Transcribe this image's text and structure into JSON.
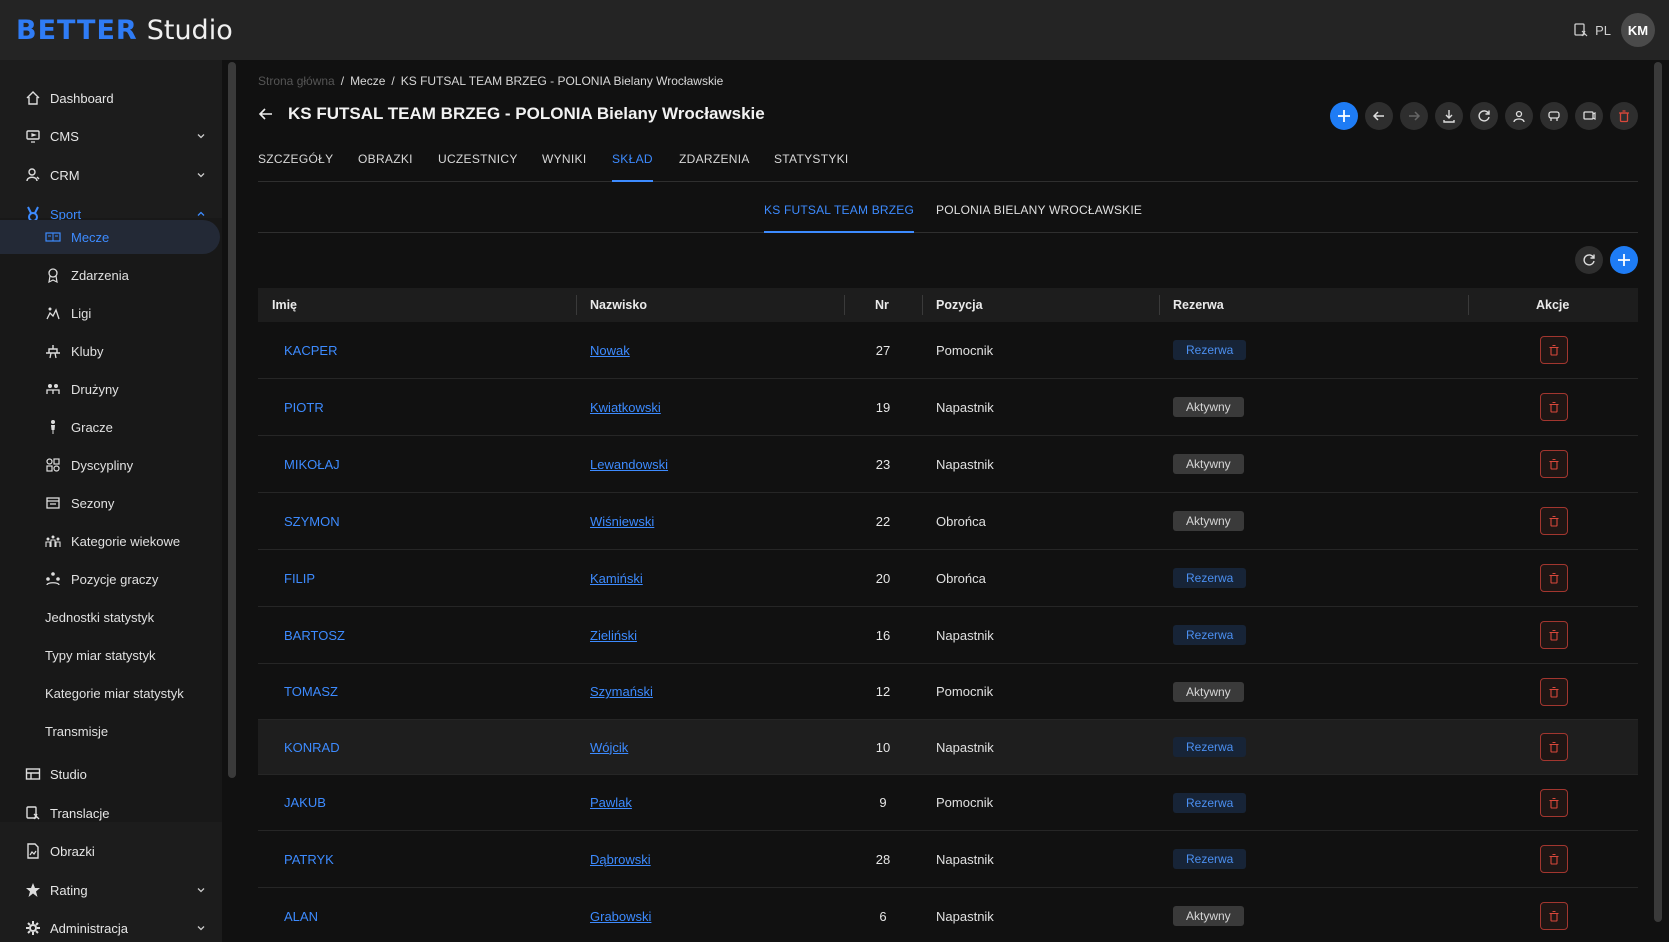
{
  "app": {
    "brand": "BETTER",
    "name": "Studio",
    "lang": "PL",
    "user_initials": "KM"
  },
  "sidebar": {
    "items": [
      {
        "label": "Dashboard",
        "icon": "home-icon"
      },
      {
        "label": "CMS",
        "icon": "monitor-icon"
      },
      {
        "label": "CRM",
        "icon": "user-icon"
      },
      {
        "label": "Sport",
        "icon": "medal-icon"
      },
      {
        "label": "Studio",
        "icon": "layout-icon"
      },
      {
        "label": "Translacje",
        "icon": "translate-icon"
      },
      {
        "label": "Obrazki",
        "icon": "image-file-icon"
      },
      {
        "label": "Rating",
        "icon": "star-icon"
      },
      {
        "label": "Administracja",
        "icon": "gear-icon"
      }
    ],
    "sport_sub": [
      {
        "label": "Mecze",
        "icon": "scoreboard-icon"
      },
      {
        "label": "Zdarzenia",
        "icon": "award-icon"
      },
      {
        "label": "Ligi",
        "icon": "league-icon"
      },
      {
        "label": "Kluby",
        "icon": "podium-icon"
      },
      {
        "label": "Drużyny",
        "icon": "team-icon"
      },
      {
        "label": "Gracze",
        "icon": "player-icon"
      },
      {
        "label": "Dyscypliny",
        "icon": "disciplines-icon"
      },
      {
        "label": "Sezony",
        "icon": "season-icon"
      },
      {
        "label": "Kategorie wiekowe",
        "icon": "age-groups-icon"
      },
      {
        "label": "Pozycje graczy",
        "icon": "formation-icon"
      },
      {
        "label": "Jednostki statystyk"
      },
      {
        "label": "Typy miar statystyk"
      },
      {
        "label": "Kategorie miar statystyk"
      },
      {
        "label": "Transmisje"
      }
    ]
  },
  "breadcrumb": [
    "Strona główna",
    "Mecze",
    "KS FUTSAL TEAM BRZEG - POLONIA Bielany Wrocławskie"
  ],
  "page_title": "KS FUTSAL TEAM BRZEG - POLONIA Bielany Wrocławskie",
  "tabs": [
    "SZCZEGÓŁY",
    "OBRAZKI",
    "UCZESTNICY",
    "WYNIKI",
    "SKŁAD",
    "ZDARZENIA",
    "STATYSTYKI"
  ],
  "team_tabs": [
    "KS FUTSAL TEAM BRZEG",
    "POLONIA BIELANY WROCŁAWSKIE"
  ],
  "table": {
    "headers": {
      "first_name": "Imię",
      "last_name": "Nazwisko",
      "nr": "Nr",
      "position": "Pozycja",
      "reserve": "Rezerwa",
      "actions": "Akcje"
    },
    "rows": [
      {
        "first": "KACPER",
        "last": "Nowak",
        "nr": "27",
        "pos": "Pomocnik",
        "status": "Rezerwa"
      },
      {
        "first": "PIOTR",
        "last": "Kwiatkowski",
        "nr": "19",
        "pos": "Napastnik",
        "status": "Aktywny"
      },
      {
        "first": "MIKOŁAJ",
        "last": "Lewandowski",
        "nr": "23",
        "pos": "Napastnik",
        "status": "Aktywny"
      },
      {
        "first": "SZYMON",
        "last": "Wiśniewski",
        "nr": "22",
        "pos": "Obrońca",
        "status": "Aktywny"
      },
      {
        "first": "FILIP",
        "last": "Kamiński",
        "nr": "20",
        "pos": "Obrońca",
        "status": "Rezerwa"
      },
      {
        "first": "BARTOSZ",
        "last": "Zieliński",
        "nr": "16",
        "pos": "Napastnik",
        "status": "Rezerwa"
      },
      {
        "first": "TOMASZ",
        "last": "Szymański",
        "nr": "12",
        "pos": "Pomocnik",
        "status": "Aktywny"
      },
      {
        "first": "KONRAD",
        "last": "Wójcik",
        "nr": "10",
        "pos": "Napastnik",
        "status": "Rezerwa"
      },
      {
        "first": "JAKUB",
        "last": "Pawlak",
        "nr": "9",
        "pos": "Pomocnik",
        "status": "Rezerwa"
      },
      {
        "first": "PATRYK",
        "last": "Dąbrowski",
        "nr": "28",
        "pos": "Napastnik",
        "status": "Rezerwa"
      },
      {
        "first": "ALAN",
        "last": "Grabowski",
        "nr": "6",
        "pos": "Napastnik",
        "status": "Aktywny"
      }
    ]
  },
  "colors": {
    "accent": "#1e7cf5",
    "link": "#3d8bff",
    "danger": "#d9483b"
  }
}
